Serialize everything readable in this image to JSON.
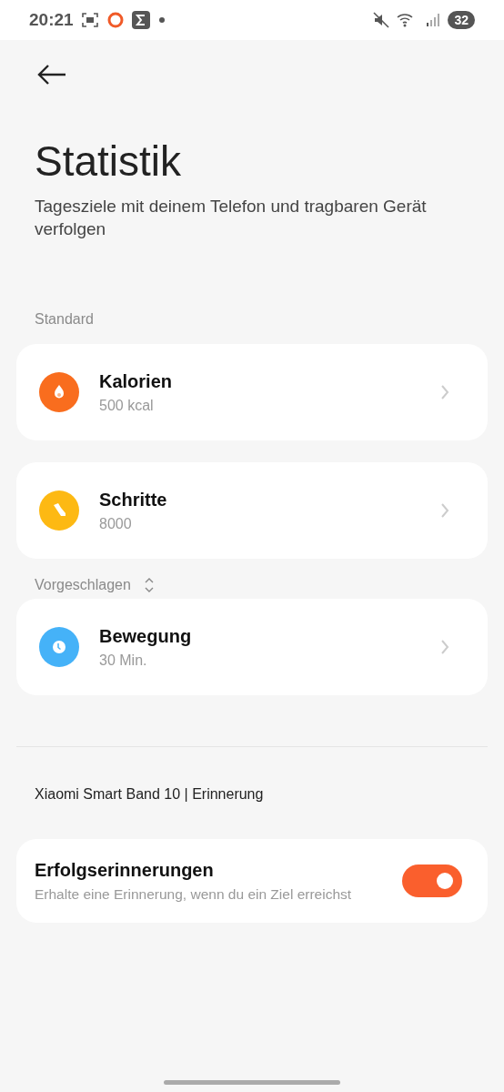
{
  "status_bar": {
    "time": "20:21",
    "battery": "32"
  },
  "title": "Statistik",
  "subtitle": "Tagesziele mit deinem Telefon und tragbaren Gerät verfolgen",
  "sections": [
    {
      "label": "Standard",
      "kind": "plain",
      "goals": [
        {
          "kind": "flame",
          "color": "#f96d1e",
          "name": "Kalorien",
          "value": "500 kcal"
        },
        {
          "kind": "shoe",
          "color": "#fdb913",
          "name": "Schritte",
          "value": "8000"
        }
      ]
    },
    {
      "label": "Vorgeschlagen",
      "kind": "sortable",
      "goals": [
        {
          "kind": "clock",
          "color": "#45b2f8",
          "name": "Bewegung",
          "value": "30 Min."
        }
      ]
    }
  ],
  "device_label": "Xiaomi Smart Band 10 | Erinnerung",
  "reminder": {
    "title": "Erfolgserinnerungen",
    "description": "Erhalte eine Erinnerung, wenn du ein Ziel erreichst",
    "on": true
  }
}
